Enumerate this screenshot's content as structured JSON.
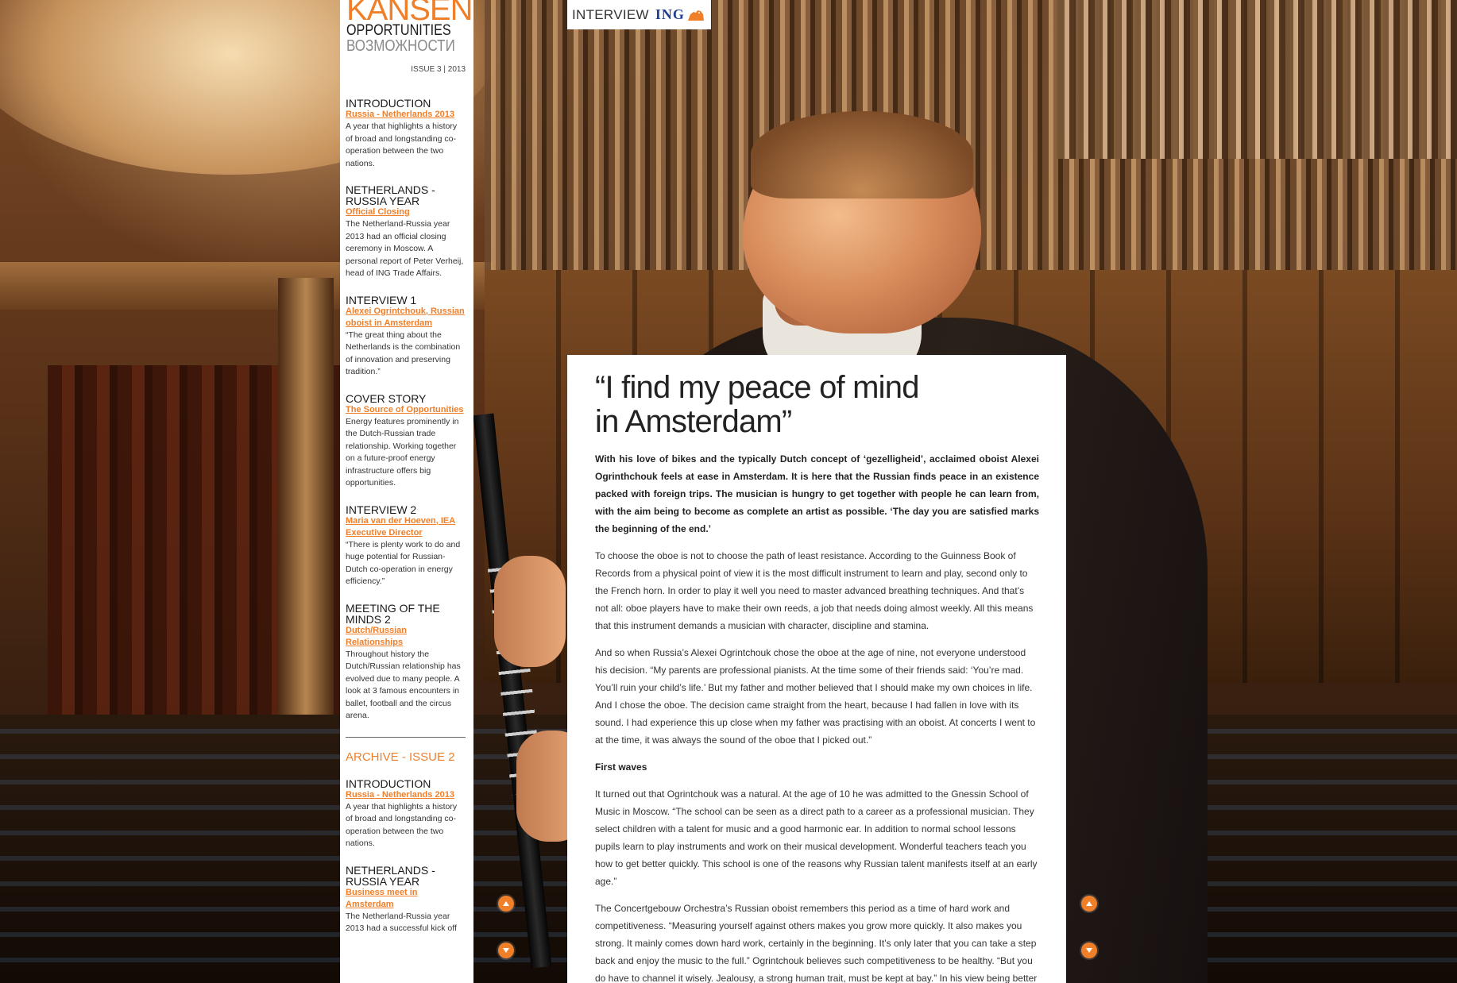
{
  "logo": {
    "line1": "KANSEN",
    "line2": "OPPORTUNITIES",
    "line3": "ВОЗМОЖНОСТИ"
  },
  "issue": "ISSUE 3 | 2013",
  "header": {
    "section": "INTERVIEW",
    "brand": "ING"
  },
  "sidebar": {
    "sections": [
      {
        "heading": "INTRODUCTION",
        "link": "Russia - Netherlands 2013",
        "text": "A year that highlights a history of broad and longstanding co-operation between the two nations."
      },
      {
        "heading": "NETHERLANDS - RUSSIA YEAR",
        "link": "Official Closing",
        "text": "The Netherland-Russia year 2013 had an official closing ceremony in Moscow. A personal report of Peter Verheij, head of ING Trade Affairs."
      },
      {
        "heading": "INTERVIEW 1",
        "link": "Alexei Ogrintchouk, Russian oboist in Amsterdam",
        "text": "“The great thing about the Netherlands is the combination of innovation and preserving tradition.”"
      },
      {
        "heading": "COVER STORY",
        "link": "The Source of Opportunities",
        "text": "Energy features prominently in the Dutch-Russian trade relationship. Working together on a future-proof energy infrastructure offers big opportunities."
      },
      {
        "heading": "INTERVIEW 2",
        "link": "Maria van der Hoeven, IEA Executive Director",
        "text": "“There is plenty work to do and huge potential for Russian-Dutch co-operation in energy efficiency.”"
      },
      {
        "heading": "MEETING OF THE MINDS 2",
        "link": "Dutch/Russian Relationships",
        "text": "Throughout history the Dutch/Russian relationship has evolved due to many people. A look at 3 famous encounters in ballet, football and the circus arena."
      }
    ],
    "archive_heading": "ARCHIVE - ISSUE 2",
    "archive_sections": [
      {
        "heading": "INTRODUCTION",
        "link": "Russia - Netherlands 2013",
        "text": "A year that highlights a history of broad and longstanding co-operation between the two nations."
      },
      {
        "heading": "NETHERLANDS - RUSSIA YEAR",
        "link": "Business meet in Amsterdam",
        "text": "The Netherland-Russia year 2013 had a successful kick off"
      }
    ]
  },
  "article": {
    "title_line1": "“I find my peace of mind",
    "title_line2": "in Amsterdam”",
    "lead": "With his love of bikes and the typically Dutch concept of ‘gezelligheid’, acclaimed oboist Alexei Ogrinthchouk feels at ease in Amsterdam. It is here that the Russian finds peace in an existence packed with foreign trips. The musician is hungry to get together with people he can learn from, with the aim being to become as complete an artist as possible. ‘The day you are satisfied marks the beginning of the end.’",
    "p1": "To choose the oboe is not to choose the path of least resistance. According to the Guinness Book of Records from a physical point of view it is the most difficult instrument to learn and play, second only to the French horn. In order to play it well you need to master advanced breathing techniques. And that’s not all: oboe players have to make their own reeds, a job that needs doing almost weekly. All this means that this instrument demands a musician with character, discipline and stamina.",
    "p2": "And so when Russia’s Alexei Ogrintchouk chose the oboe at the age of nine, not everyone understood his decision. “My parents are professional pianists. At the time some of their friends said: ‘You’re mad. You’ll ruin your child’s life.’ But my father and mother believed that I should make my own choices in life. And I chose the oboe. The decision came straight from the heart, because I had fallen in love with its sound. I had experience this up close when my father was practising with an oboist. At concerts I went to at the time, it was always the sound of the oboe that I picked out.”",
    "subhead": "First waves",
    "p3": "It turned out that Ogrintchouk was a natural. At the age of 10 he was admitted to the Gnessin School of Music in Moscow. “The school can be seen as a direct path to a career as a professional musician. They select children with a talent for music and a good harmonic ear. In addition to normal school lessons pupils learn to play instruments and work on their musical development. Wonderful teachers teach you how to get better quickly. This school is one of the reasons why Russian talent manifests itself at an early age.”",
    "p4": "The Concertgebouw Orchestra’s Russian oboist remembers this period as a time of hard work and competitiveness. “Measuring yourself against others makes you grow more quickly. It also makes you strong. It mainly comes down hard work, certainly in the beginning. It’s only later that you can take a step back and enjoy the music to the full.” Ogrintchouk believes such competitiveness to be healthy. “But you do have to channel it wisely. Jealousy, a strong human trait, must be kept at bay.” In his view being better than someone else should never be an end in itself. “Your prime motivation should always be to make"
  },
  "colors": {
    "accent": "#f07f2a",
    "ing_blue": "#1f3f8f"
  },
  "icons": {
    "scroll_up": "arrow-up-icon",
    "scroll_down": "arrow-down-icon",
    "brand": "lion-icon"
  }
}
